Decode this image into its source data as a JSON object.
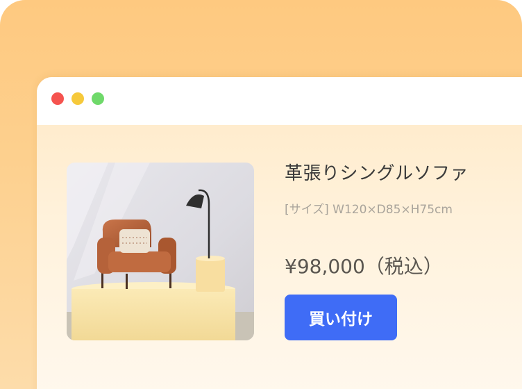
{
  "product": {
    "title": "革張りシングルソファ",
    "size": "[サイズ] W120×D85×H75cm",
    "price": "¥98,000（税込）",
    "buy_label": "買い付け"
  },
  "window": {
    "controls": [
      "close",
      "minimize",
      "maximize"
    ]
  },
  "colors": {
    "background": "#fec980",
    "accent_button": "#3f6cf6",
    "close_dot": "#f5534f",
    "minimize_dot": "#f6c93b",
    "maximize_dot": "#6fd96a"
  },
  "icons": [
    "window-close-icon",
    "window-minimize-icon",
    "window-maximize-icon"
  ]
}
